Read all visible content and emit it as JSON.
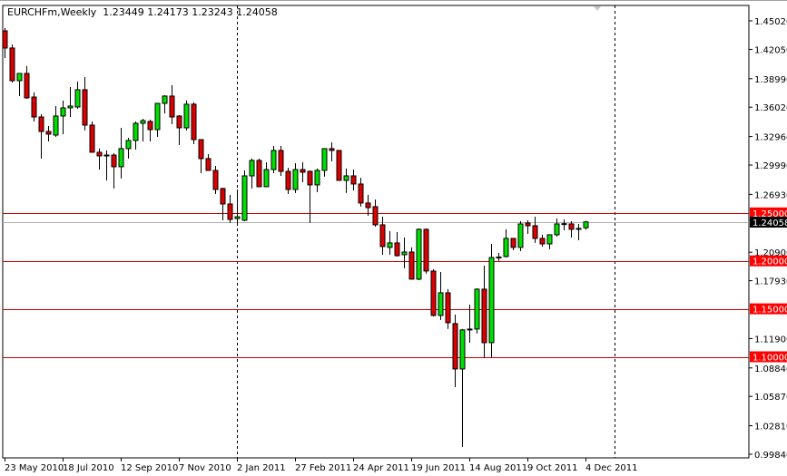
{
  "header": {
    "symbol_timeframe": "EURCHFm,Weekly",
    "ohlc": "1.23449 1.24173 1.23243 1.24058"
  },
  "colors": {
    "bull": "#00e000",
    "bear": "#dd0000",
    "level": "#cc0000",
    "current": "#b0b0b0"
  },
  "chart_data": {
    "type": "candlestick",
    "title": "EURCHFm,Weekly",
    "ylim": [
      0.9984,
      1.4502
    ],
    "y_ticks": [
      "1.45020",
      "1.42050",
      "1.38990",
      "1.36020",
      "1.32960",
      "1.29990",
      "1.26930",
      "1.20900",
      "1.17930",
      "1.11900",
      "1.08840",
      "1.05870",
      "1.02810",
      "0.99840"
    ],
    "x_labels": [
      {
        "index": 0,
        "label": "23 May 2010"
      },
      {
        "index": 8,
        "label": "18 Jul 2010"
      },
      {
        "index": 16,
        "label": "12 Sep 2010"
      },
      {
        "index": 24,
        "label": "7 Nov 2010"
      },
      {
        "index": 32,
        "label": "2 Jan 2011"
      },
      {
        "index": 40,
        "label": "27 Feb 2011"
      },
      {
        "index": 48,
        "label": "24 Apr 2011"
      },
      {
        "index": 56,
        "label": "19 Jun 2011"
      },
      {
        "index": 64,
        "label": "14 Aug 2011"
      },
      {
        "index": 72,
        "label": "9 Oct 2011"
      },
      {
        "index": 80,
        "label": "4 Dec 2011"
      }
    ],
    "period_separators": [
      32,
      84
    ],
    "horizontal_levels": [
      {
        "value": 1.25,
        "label": "1.25000"
      },
      {
        "value": 1.2,
        "label": "1.20000"
      },
      {
        "value": 1.15,
        "label": "1.15000"
      },
      {
        "value": 1.1,
        "label": "1.10000"
      }
    ],
    "current_price": {
      "value": 1.24058,
      "label": "1.24058"
    },
    "ohlc": [
      [
        1.4398,
        1.4426,
        1.4115,
        1.4219
      ],
      [
        1.4219,
        1.4256,
        1.3859,
        1.3878
      ],
      [
        1.3878,
        1.3954,
        1.3718,
        1.3954
      ],
      [
        1.3954,
        1.403,
        1.3689,
        1.3699
      ],
      [
        1.3708,
        1.3756,
        1.3453,
        1.35
      ],
      [
        1.35,
        1.3529,
        1.3066,
        1.3349
      ],
      [
        1.3349,
        1.3406,
        1.3245,
        1.3321
      ],
      [
        1.3311,
        1.3614,
        1.3292,
        1.351
      ],
      [
        1.351,
        1.3671,
        1.3321,
        1.3595
      ],
      [
        1.3595,
        1.3812,
        1.35,
        1.3614
      ],
      [
        1.3604,
        1.3869,
        1.3585,
        1.3784
      ],
      [
        1.3784,
        1.3916,
        1.3359,
        1.3415
      ],
      [
        1.3415,
        1.3453,
        1.3132,
        1.3132
      ],
      [
        1.3132,
        1.317,
        1.2952,
        1.3094
      ],
      [
        1.3103,
        1.3151,
        1.2839,
        1.3103
      ],
      [
        1.3103,
        1.3122,
        1.2754,
        1.2981
      ],
      [
        1.2981,
        1.3387,
        1.2858,
        1.317
      ],
      [
        1.317,
        1.3283,
        1.3066,
        1.3255
      ],
      [
        1.3255,
        1.3453,
        1.316,
        1.3434
      ],
      [
        1.3434,
        1.3481,
        1.3245,
        1.3462
      ],
      [
        1.3453,
        1.3472,
        1.3245,
        1.3368
      ],
      [
        1.3368,
        1.3642,
        1.3292,
        1.3642
      ],
      [
        1.3642,
        1.3727,
        1.3538,
        1.3718
      ],
      [
        1.3718,
        1.3831,
        1.3425,
        1.35
      ],
      [
        1.351,
        1.3519,
        1.3207,
        1.3387
      ],
      [
        1.3387,
        1.3671,
        1.3359,
        1.3633
      ],
      [
        1.3633,
        1.3652,
        1.3217,
        1.3264
      ],
      [
        1.3264,
        1.3264,
        1.2914,
        1.3066
      ],
      [
        1.3066,
        1.3113,
        1.2943,
        1.2943
      ],
      [
        1.2943,
        1.299,
        1.2697,
        1.2744
      ],
      [
        1.2754,
        1.2763,
        1.2423,
        1.2593
      ],
      [
        1.2593,
        1.2688,
        1.2395,
        1.2432
      ],
      [
        1.2441,
        1.2744,
        1.2385,
        1.246
      ],
      [
        1.2423,
        1.2943,
        1.2413,
        1.2886
      ],
      [
        1.2886,
        1.3066,
        1.2754,
        1.3047
      ],
      [
        1.3047,
        1.3066,
        1.2773,
        1.2773
      ],
      [
        1.2773,
        1.3028,
        1.2773,
        1.2952
      ],
      [
        1.2952,
        1.3198,
        1.2914,
        1.3151
      ],
      [
        1.3151,
        1.3198,
        1.2886,
        1.2933
      ],
      [
        1.2933,
        1.2971,
        1.2697,
        1.2744
      ],
      [
        1.2744,
        1.3018,
        1.2707,
        1.2952
      ],
      [
        1.2952,
        1.3028,
        1.282,
        1.2924
      ],
      [
        1.2933,
        1.2943,
        1.2395,
        1.2792
      ],
      [
        1.2792,
        1.2962,
        1.2716,
        1.2943
      ],
      [
        1.2943,
        1.317,
        1.2877,
        1.317
      ],
      [
        1.317,
        1.3236,
        1.3037,
        1.3151
      ],
      [
        1.3151,
        1.3151,
        1.2839,
        1.2839
      ],
      [
        1.2839,
        1.2962,
        1.2707,
        1.2886
      ],
      [
        1.2886,
        1.2952,
        1.2735,
        1.2801
      ],
      [
        1.2801,
        1.2867,
        1.2565,
        1.2603
      ],
      [
        1.2603,
        1.2688,
        1.247,
        1.2555
      ],
      [
        1.2565,
        1.264,
        1.2357,
        1.2376
      ],
      [
        1.2376,
        1.246,
        1.2064,
        1.2149
      ],
      [
        1.214,
        1.231,
        1.2064,
        1.2187
      ],
      [
        1.2187,
        1.23,
        1.2045,
        1.2054
      ],
      [
        1.2064,
        1.2243,
        1.1922,
        1.2092
      ],
      [
        1.2092,
        1.214,
        1.1809,
        1.1809
      ],
      [
        1.1809,
        1.2338,
        1.1799,
        1.2329
      ],
      [
        1.2329,
        1.2338,
        1.1866,
        1.1894
      ],
      [
        1.1894,
        1.1913,
        1.1421,
        1.1431
      ],
      [
        1.1431,
        1.1884,
        1.1384,
        1.1667
      ],
      [
        1.1667,
        1.1705,
        1.1289,
        1.1355
      ],
      [
        1.1346,
        1.144,
        1.0684,
        1.0873
      ],
      [
        1.0873,
        1.1289,
        1.0061,
        1.128
      ],
      [
        1.128,
        1.1544,
        1.1147,
        1.1289
      ],
      [
        1.1289,
        1.1714,
        1.1242,
        1.1705
      ],
      [
        1.1705,
        1.195,
        1.0987,
        1.1147
      ],
      [
        1.1147,
        1.2177,
        1.0996,
        1.2035
      ],
      [
        1.2035,
        1.2083,
        1.1998,
        1.204
      ],
      [
        1.2045,
        1.2329,
        1.2035,
        1.2234
      ],
      [
        1.2234,
        1.2234,
        1.2111,
        1.214
      ],
      [
        1.214,
        1.2413,
        1.2102,
        1.2385
      ],
      [
        1.2395,
        1.2423,
        1.2281,
        1.2366
      ],
      [
        1.2366,
        1.246,
        1.2187,
        1.2234
      ],
      [
        1.2234,
        1.2272,
        1.2149,
        1.2177
      ],
      [
        1.2177,
        1.2272,
        1.2121,
        1.2272
      ],
      [
        1.2272,
        1.2441,
        1.2253,
        1.2385
      ],
      [
        1.2385,
        1.2432,
        1.2319,
        1.2388
      ],
      [
        1.2385,
        1.2413,
        1.2243,
        1.2329
      ],
      [
        1.2338,
        1.2385,
        1.2215,
        1.2335
      ],
      [
        1.23449,
        1.24173,
        1.23243,
        1.24058
      ]
    ]
  }
}
